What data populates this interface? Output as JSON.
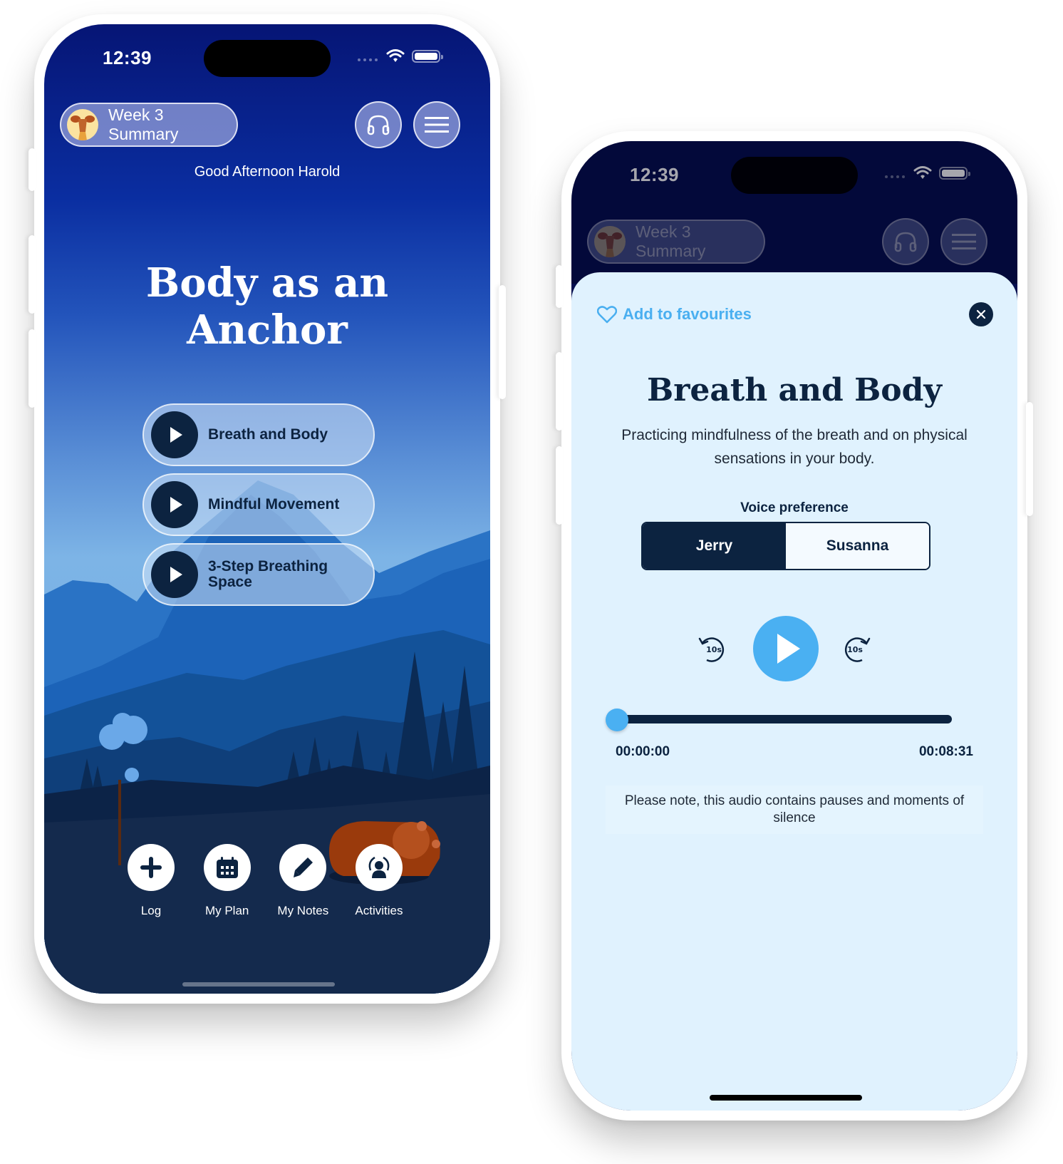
{
  "left_phone": {
    "status_bar": {
      "time": "12:39"
    },
    "header": {
      "week_pill_label": "Week 3 Summary",
      "avatar_icon": "deer-avatar-icon",
      "headphones_icon": "headphones-icon",
      "menu_icon": "hamburger-menu-icon"
    },
    "greeting": "Good Afternoon Harold",
    "session_title": "Body as an Anchor",
    "sessions": [
      {
        "label": "Breath and Body",
        "icon": "play-icon"
      },
      {
        "label": "Mindful Movement",
        "icon": "play-icon"
      },
      {
        "label": "3-Step Breathing Space",
        "icon": "play-icon"
      }
    ],
    "bottom_nav": [
      {
        "label": "Log",
        "icon": "plus-icon"
      },
      {
        "label": "My Plan",
        "icon": "calendar-icon"
      },
      {
        "label": "My Notes",
        "icon": "pen-icon"
      },
      {
        "label": "Activities",
        "icon": "person-broadcast-icon"
      }
    ]
  },
  "right_phone": {
    "status_bar": {
      "time": "12:39"
    },
    "header": {
      "week_pill_label": "Week 3 Summary",
      "avatar_icon": "deer-avatar-icon",
      "headphones_icon": "headphones-icon",
      "menu_icon": "hamburger-menu-icon"
    },
    "sheet": {
      "favourite_label": "Add to favourites",
      "title": "Breath and Body",
      "description": "Practicing mindfulness of the breath and on physical sensations in your body.",
      "voice_preference_label": "Voice preference",
      "voice_options": [
        {
          "label": "Jerry",
          "selected": true
        },
        {
          "label": "Susanna",
          "selected": false
        }
      ],
      "skip_back_label": "10s",
      "skip_forward_label": "10s",
      "progress_fraction": 0,
      "time_elapsed": "00:00:00",
      "time_total": "00:08:31",
      "note": "Please note, this audio contains pauses and moments of silence"
    }
  },
  "colors": {
    "navy": "#0c2340",
    "accent_blue": "#4ab0f2",
    "sheet_bg": "#e0f2fe",
    "sky_top": "#061575"
  }
}
